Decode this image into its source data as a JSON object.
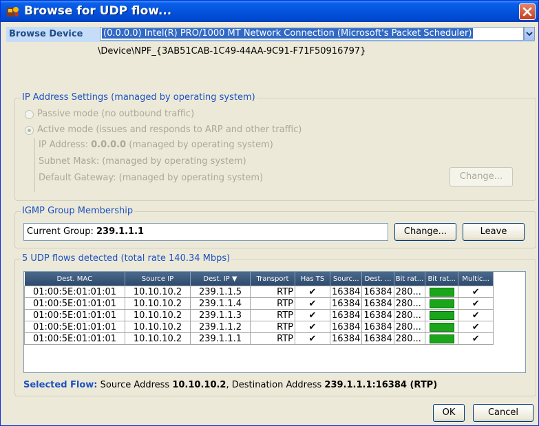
{
  "window": {
    "title": "Browse for UDP flow..."
  },
  "browse": {
    "label": "Browse Device",
    "selected": "(0.0.0.0) Intel(R) PRO/1000 MT Network Connection (Microsoft's Packet Scheduler)",
    "device_path": "\\Device\\NPF_{3AB51CAB-1C49-44AA-9C91-F71F50916797}"
  },
  "ip_settings": {
    "legend": "IP Address Settings (managed by operating system)",
    "passive_mode": "Passive mode (no outbound traffic)",
    "active_mode": "Active mode (issues and responds to ARP and other traffic)",
    "ip_prefix": "IP Address:",
    "ip_value": "0.0.0.0",
    "ip_suffix": "(managed by operating system)",
    "subnet_mask": "Subnet Mask: (managed by operating system)",
    "default_gateway": "Default Gateway: (managed by operating system)",
    "change_label": "Change..."
  },
  "igmp": {
    "legend": "IGMP Group Membership",
    "current_prefix": "Current Group:",
    "current_value": "239.1.1.1",
    "change_label": "Change...",
    "leave_label": "Leave"
  },
  "flows": {
    "legend": "5 UDP flows detected (total rate 140.34 Mbps)",
    "columns": [
      "Dest. MAC",
      "Source IP",
      "Dest. IP",
      "Transport",
      "Has TS",
      "Sourc...",
      "Dest. ...",
      "Bit rat...",
      "Bit rat...",
      "Multic..."
    ],
    "sort_indicator": "▼",
    "rows": [
      {
        "mac": "01:00:5E:01:01:01",
        "src": "10.10.10.2",
        "dst": "239.1.1.5",
        "transport": "RTP",
        "has_ts": "✔",
        "sport": "16384",
        "dport": "16384",
        "bitrate": "280...",
        "multicast": "✔"
      },
      {
        "mac": "01:00:5E:01:01:01",
        "src": "10.10.10.2",
        "dst": "239.1.1.4",
        "transport": "RTP",
        "has_ts": "✔",
        "sport": "16384",
        "dport": "16384",
        "bitrate": "280...",
        "multicast": "✔"
      },
      {
        "mac": "01:00:5E:01:01:01",
        "src": "10.10.10.2",
        "dst": "239.1.1.3",
        "transport": "RTP",
        "has_ts": "✔",
        "sport": "16384",
        "dport": "16384",
        "bitrate": "280...",
        "multicast": "✔"
      },
      {
        "mac": "01:00:5E:01:01:01",
        "src": "10.10.10.2",
        "dst": "239.1.1.2",
        "transport": "RTP",
        "has_ts": "✔",
        "sport": "16384",
        "dport": "16384",
        "bitrate": "280...",
        "multicast": "✔"
      },
      {
        "mac": "01:00:5E:01:01:01",
        "src": "10.10.10.2",
        "dst": "239.1.1.1",
        "transport": "RTP",
        "has_ts": "✔",
        "sport": "16384",
        "dport": "16384",
        "bitrate": "280...",
        "multicast": "✔"
      }
    ],
    "selected_label": "Selected Flow:",
    "selected_src_prefix": "Source Address",
    "selected_src": "10.10.10.2",
    "selected_dst_prefix": ", Destination Address",
    "selected_dst": "239.1.1.1:16384 (RTP)"
  },
  "buttons": {
    "ok": "OK",
    "cancel": "Cancel"
  },
  "colors": {
    "titlebar": "#0453dd",
    "legend": "#1d51c2",
    "bitrate_bar": "#1aa51a",
    "selection": "#316ac5"
  }
}
